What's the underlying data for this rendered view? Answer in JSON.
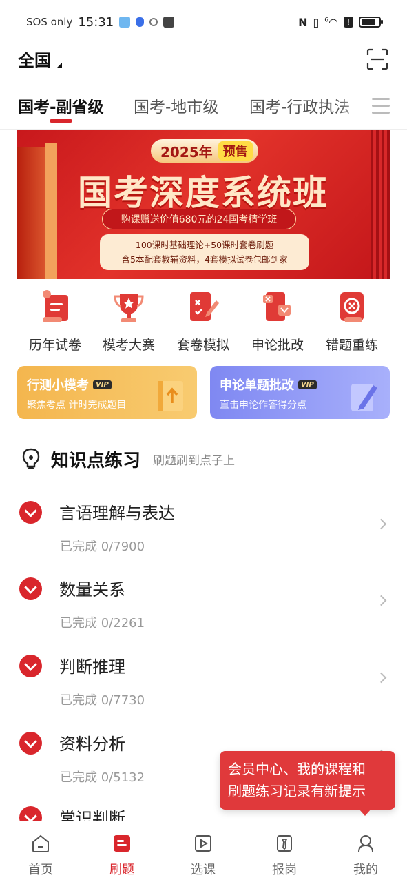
{
  "status_bar": {
    "carrier": "SOS only",
    "time": "15:31",
    "network": "6"
  },
  "header": {
    "region": "全国",
    "scan_icon": "scan-icon"
  },
  "tabs": [
    {
      "label": "国考-副省级",
      "active": true
    },
    {
      "label": "国考-地市级",
      "active": false
    },
    {
      "label": "国考-行政执法",
      "active": false
    }
  ],
  "banner": {
    "year_tag": "2025年",
    "presale": "预售",
    "title": "国考深度系统班",
    "gift": "购课赠送价值680元的24国考精学班",
    "detail_line1": "100课时基础理论+50课时套卷刷题",
    "detail_line2": "含5本配套教辅资料，4套模拟试卷包邮到家"
  },
  "quick_actions": [
    {
      "label": "历年试卷",
      "icon": "past-papers-icon"
    },
    {
      "label": "模考大赛",
      "icon": "trophy-icon"
    },
    {
      "label": "套卷模拟",
      "icon": "mock-exam-icon"
    },
    {
      "label": "申论批改",
      "icon": "essay-grading-icon"
    },
    {
      "label": "错题重练",
      "icon": "wrong-questions-icon"
    }
  ],
  "promos": [
    {
      "title": "行测小模考",
      "vip": "VIP",
      "subtitle": "聚焦考点 计时完成题目",
      "color": "#f4b64e"
    },
    {
      "title": "申论单题批改",
      "vip": "VIP",
      "subtitle": "直击申论作答得分点",
      "color": "#7f88f2"
    }
  ],
  "section": {
    "title": "知识点练习",
    "subtitle": "刷题刷到点子上"
  },
  "topics": [
    {
      "name": "言语理解与表达",
      "progress": "已完成 0/7900"
    },
    {
      "name": "数量关系",
      "progress": "已完成 0/2261"
    },
    {
      "name": "判断推理",
      "progress": "已完成 0/7730"
    },
    {
      "name": "资料分析",
      "progress": "已完成 0/5132"
    },
    {
      "name": "常识判断",
      "progress": ""
    }
  ],
  "tooltip": {
    "line1": "会员中心、我的课程和",
    "line2": "刷题练习记录有新提示"
  },
  "bottom_nav": [
    {
      "label": "首页",
      "icon": "home-icon",
      "active": false
    },
    {
      "label": "刷题",
      "icon": "practice-icon",
      "active": true
    },
    {
      "label": "选课",
      "icon": "courses-icon",
      "active": false
    },
    {
      "label": "报岗",
      "icon": "jobs-icon",
      "active": false
    },
    {
      "label": "我的",
      "icon": "profile-icon",
      "active": false
    }
  ],
  "colors": {
    "accent": "#d9262c",
    "banner": "#d42724"
  }
}
